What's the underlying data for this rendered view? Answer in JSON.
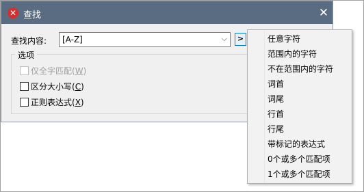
{
  "dialog": {
    "title": "查找",
    "close_glyph": "✕",
    "icon_glyph": "✕"
  },
  "find": {
    "label": "查找内容:",
    "value": "[A-Z]",
    "dropdown_glyph": "⌵",
    "regex_button_label": ">"
  },
  "options": {
    "group_label": "选项",
    "items": [
      {
        "text": "仅全字匹配(",
        "key": "W",
        "suffix": ")",
        "checked": false,
        "disabled": true
      },
      {
        "text": "区分大小写(",
        "key": "C",
        "suffix": ")",
        "checked": false,
        "disabled": false
      },
      {
        "text": "正则表达式(",
        "key": "X",
        "suffix": ")",
        "checked": false,
        "disabled": false
      }
    ]
  },
  "regex_menu": {
    "items": [
      "任意字符",
      "范围内的字符",
      "不在范围内的字符",
      "词首",
      "词尾",
      "行首",
      "行尾",
      "带标记的表达式",
      "0个或多个匹配项",
      "1个或多个匹配项"
    ]
  },
  "colors": {
    "titlebar": "#5a6c82",
    "dialog_bg": "#f0f0f0",
    "menu_bg": "#f2f2f2",
    "app_icon": "#d32f2f",
    "focus_border": "#0078d7"
  }
}
